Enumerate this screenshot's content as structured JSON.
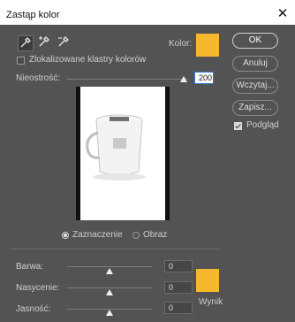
{
  "window": {
    "title": "Zastąp kolor",
    "close_glyph": "✕"
  },
  "tools": [
    {
      "name": "eyedropper-icon"
    },
    {
      "name": "eyedropper-plus-icon"
    },
    {
      "name": "eyedropper-minus-icon"
    }
  ],
  "localized_clusters": {
    "label": "Zlokalizowane klastry kolorów",
    "checked": false
  },
  "color": {
    "label": "Kolor:",
    "swatch": "#f5b82e"
  },
  "fuzziness": {
    "label": "Nieostrość:",
    "value": "200",
    "fraction": 1.0
  },
  "buttons": {
    "ok": "OK",
    "cancel": "Anuluj",
    "load": "Wczytaj...",
    "save": "Zapisz..."
  },
  "preview_toggle": {
    "label": "Podgląd",
    "checked": true
  },
  "view_mode": {
    "selection": "Zaznaczenie",
    "image": "Obraz",
    "selected": "selection"
  },
  "replacement": {
    "hue": {
      "label": "Barwa:",
      "value": "0",
      "fraction": 0.5
    },
    "saturation": {
      "label": "Nasycenie:",
      "value": "0",
      "fraction": 0.5
    },
    "lightness": {
      "label": "Jasność:",
      "value": "0",
      "fraction": 0.5
    },
    "result_label": "Wynik",
    "result_swatch": "#f5b82e"
  }
}
